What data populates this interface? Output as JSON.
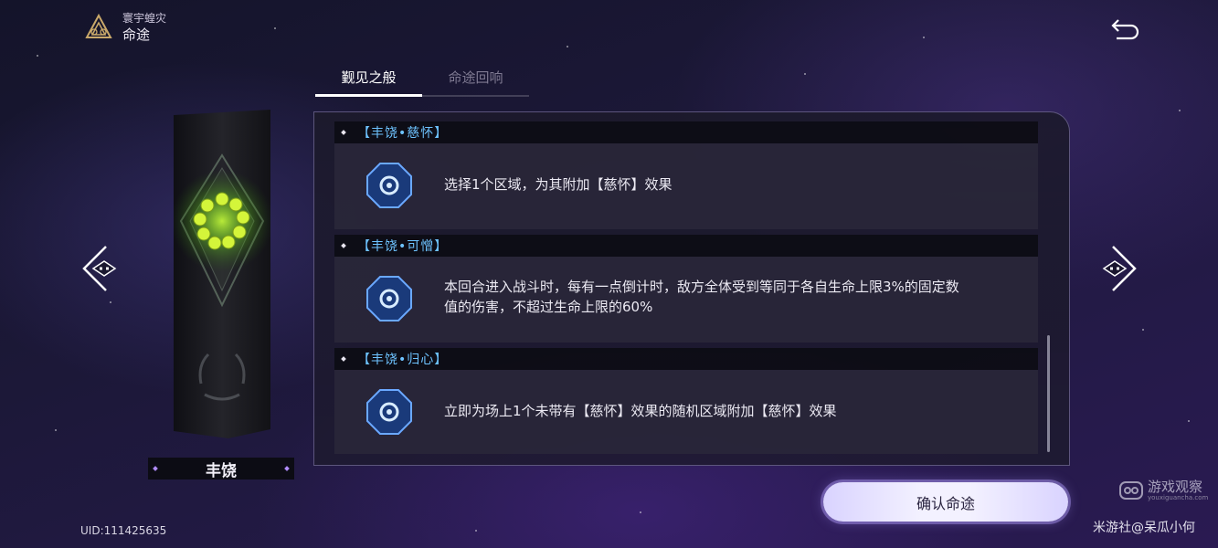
{
  "header": {
    "subtitle": "寰宇蝗灾",
    "title": "命途"
  },
  "tabs": [
    {
      "label": "觐见之般",
      "active": true
    },
    {
      "label": "命途回响",
      "active": false
    }
  ],
  "path_name": "丰饶",
  "entries": [
    {
      "name": "【丰饶•慈怀】",
      "icon": "bloom-octagon-icon",
      "lines": [
        "选择1个区域，为其附加【慈怀】效果"
      ]
    },
    {
      "name": "【丰饶•可憎】",
      "icon": "bloom-octagon-icon",
      "lines": [
        "本回合进入战斗时，每有一点倒计时，敌方全体受到等同于各自生命上限3%的固定数",
        "值的伤害，不超过生命上限的60%"
      ]
    },
    {
      "name": "【丰饶•归心】",
      "icon": "bloom-octagon-icon",
      "lines": [
        "立即为场上1个未带有【慈怀】效果的随机区域附加【慈怀】效果"
      ]
    }
  ],
  "confirm_button": "确认命途",
  "uid": "UID:111425635",
  "watermark": {
    "site_title": "游戏观察",
    "site_sub": "youxiguancha.com",
    "author": "米游社@呆瓜小何"
  },
  "colors": {
    "entry_title": "#6ec3ff",
    "accent_purple": "#b08cff"
  }
}
